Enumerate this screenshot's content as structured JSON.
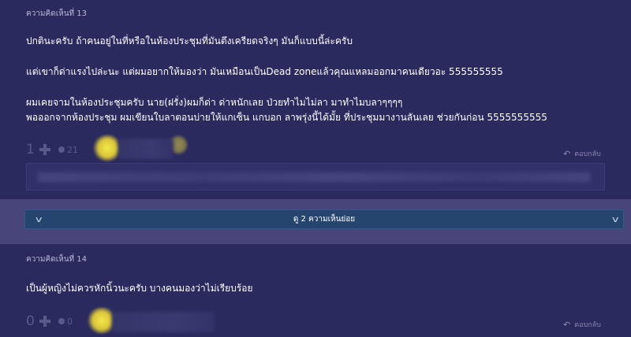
{
  "comments": [
    {
      "header": "ความคิดเห็นที่ 13",
      "lines": [
        "ปกตินะครับ ถ้าคนอยู่ในที่หรือในห้องประชุมที่มันตึงเครียดจริงๆ มันก็แบบนี้ล่ะครับ",
        "แต่เขาก็ด่าแรงไปล่ะนะ แต่ผมอยากให้มองว่า มันเหมือนเป็นDead zoneแล้วคุณแหลมออกมาคนเดียวอะ 555555555",
        "ผมเคยจามในห้องประชุมครับ นาย(ฝรั่ง)ผมก็ด่า ด่าหนักเลย ป่วยทำไมไม่ลา มาทำไมบลาๆๆๆๆ",
        "พอออกจากห้องประชุม ผมเขียนใบลาตอนบ่ายให้แกเซ็น แกบอก ลาพรุ่งนี้ได้มั้ย ที่ประชุมมางานลันเลย ช่วยกันก่อน 5555555555"
      ],
      "votes": "1",
      "emotions": "21",
      "reply_label": "ตอบกลับ"
    },
    {
      "header": "ความคิดเห็นที่ 14",
      "lines": [
        "เป็นผู้หญิงไม่ควรหักนิ้วนะครับ บางคนมองว่าไม่เรียบร้อย"
      ],
      "votes": "0",
      "emotions": "0",
      "reply_label": "ตอบกลับ"
    }
  ],
  "subcomments": {
    "expand_label": "ดู 2 ความเห็นย่อย",
    "chevron": "v"
  },
  "icons": [
    "plus-icon",
    "emotion-icon",
    "reply-arrow-icon",
    "chevron-down-icon"
  ],
  "colors": {
    "background": "#2a2a5e",
    "band": "#48457a",
    "expand_button": "#25456f",
    "muted": "#5a5a8a",
    "avatar": "#f5e84a"
  }
}
